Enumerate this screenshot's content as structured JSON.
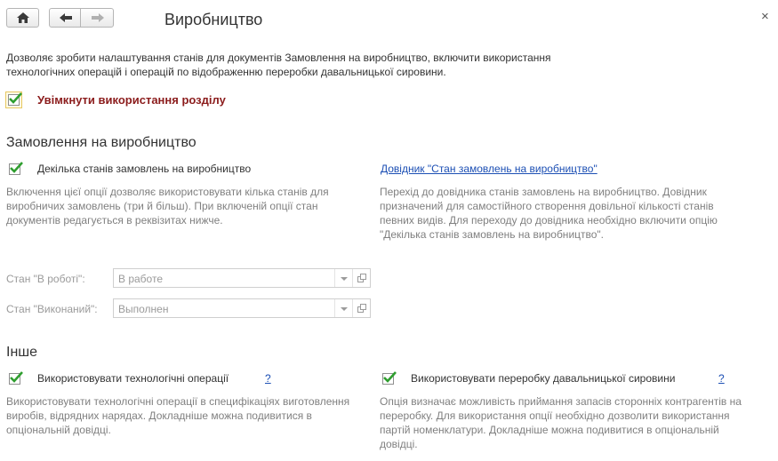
{
  "window": {
    "title": "Виробництво",
    "close_glyph": "×"
  },
  "toolbar": {
    "home_icon": "home-icon",
    "back_icon": "arrow-left-icon",
    "forward_icon": "arrow-right-icon"
  },
  "intro": {
    "description": "Дозволяє зробити налаштування станів для документів Замовлення на виробництво, включити використання технологічних операцій і операцій по відображенню переробки давальницької сировини.",
    "enable_label": "Увімкнути використання розділу",
    "enable_checked": true
  },
  "orders": {
    "heading": "Замовлення на виробництво",
    "multi_states_label": "Декілька станів замовлень на виробництво",
    "multi_states_checked": true,
    "multi_states_hint": "Включення цієї опції дозволяє використовувати кілька станів для виробничих замовлень (три й більш). При включеній опції стан документів редагується в реквізитах нижче.",
    "catalog_link": "Довідник \"Стан замовлень на виробництво\"",
    "catalog_hint": "Перехід до довідника станів замовлень на виробництво. Довідник призначений для самостійного створення довільної кількості станів певних видів. Для переходу до довідника необхідно включити опцію \"Декілька станів замовлень на виробництво\".",
    "in_progress_label": "Стан \"В роботі\":",
    "in_progress_value": "В работе",
    "done_label": "Стан \"Виконаний\":",
    "done_value": "Выполнен"
  },
  "other": {
    "heading": "Інше",
    "tech_ops_label": "Використовувати технологічні операції",
    "tech_ops_checked": true,
    "tech_ops_help": "?",
    "tech_ops_hint": "Використовувати технологічні операції в специфікаціях виготовлення виробів, відрядних нарядах. Докладніше можна подивитися в опціональній довідці.",
    "tolling_label": "Використовувати переробку давальницької сировини",
    "tolling_checked": true,
    "tolling_help": "?",
    "tolling_hint": "Опція визначає можливість приймання запасів сторонніх контрагентів на переробку. Для використання опції необхідно дозволити використання партій номенклатури. Докладніше можна подивитися в опціональній довідці."
  },
  "colors": {
    "check_green": "#2f9e2f",
    "enable_label": "#8b1c1c",
    "link": "#1c4fb4",
    "hint_gray": "#808080"
  }
}
